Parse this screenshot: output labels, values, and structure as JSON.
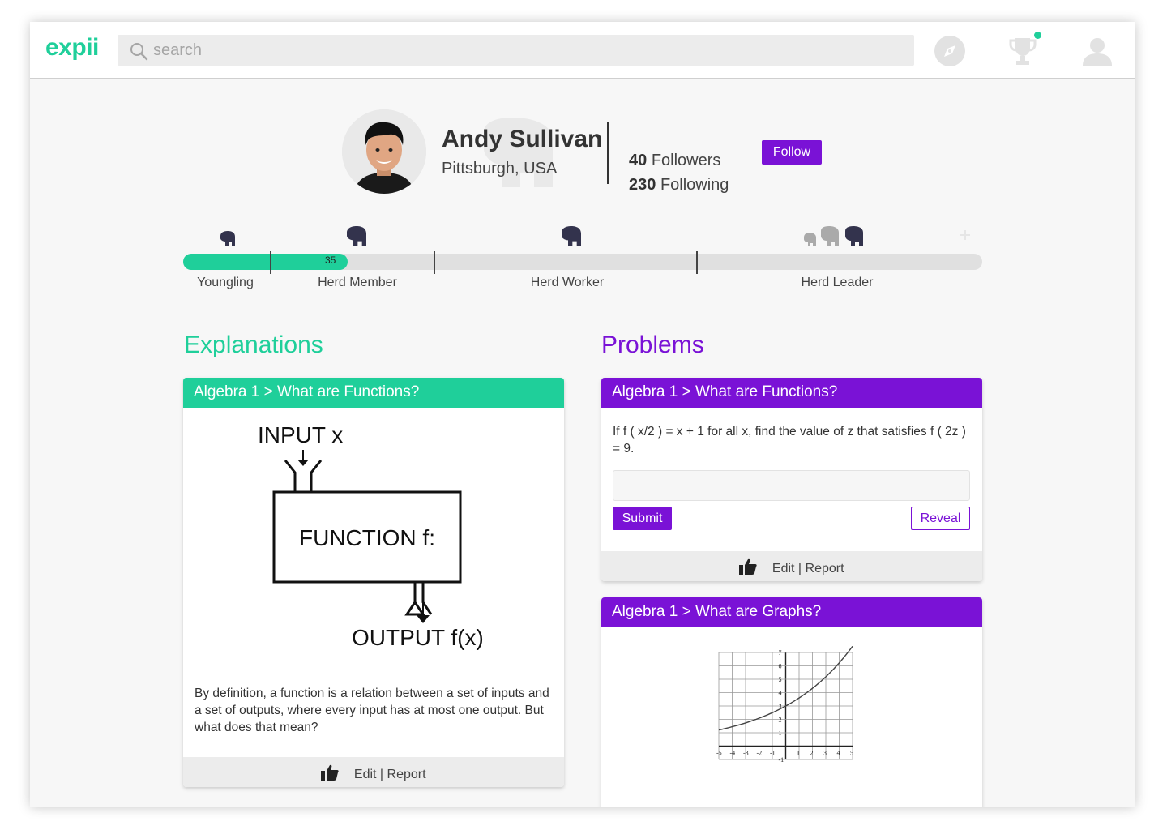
{
  "app": {
    "logo": "expii"
  },
  "search": {
    "placeholder": "search"
  },
  "topbar_icons": [
    "compass-icon",
    "trophy-icon",
    "user-icon"
  ],
  "profile": {
    "name": "Andy Sullivan",
    "location": "Pittsburgh, USA",
    "followers_count": "40",
    "followers_label": "Followers",
    "following_count": "230",
    "following_label": "Following",
    "follow_label": "Follow"
  },
  "progress": {
    "value": 35,
    "value_label": "35",
    "ranks": [
      "Youngling",
      "Herd Member",
      "Herd Worker",
      "Herd Leader"
    ]
  },
  "explanations": {
    "title": "Explanations",
    "card": {
      "header": "Algebra 1 > What are Functions?",
      "diagram": {
        "input_label": "INPUT x",
        "function_label": "FUNCTION f:",
        "output_label": "OUTPUT f(x)"
      },
      "text": "By definition, a function is a relation between a set of inputs and a set of outputs, where every input has at most one output. But what does that mean?",
      "footer": "Edit | Report"
    }
  },
  "problems": {
    "title": "Problems",
    "card1": {
      "header": "Algebra 1 > What are Functions?",
      "question": "If f ( x/2 ) = x + 1 for all x, find the value of z that satisfies f ( 2z ) = 9.",
      "submit_label": "Submit",
      "reveal_label": "Reveal",
      "footer": "Edit | Report"
    },
    "card2": {
      "header": "Algebra 1 > What are Graphs?",
      "graph": {
        "x_ticks": [
          "-5",
          "-4",
          "-3",
          "-2",
          "-1",
          "1",
          "2",
          "3",
          "4",
          "5"
        ],
        "y_ticks": [
          "7",
          "6",
          "5",
          "4",
          "3",
          "2",
          "1",
          "-1"
        ]
      }
    }
  },
  "colors": {
    "green": "#1fcf9a",
    "purple": "#7a12d6"
  }
}
